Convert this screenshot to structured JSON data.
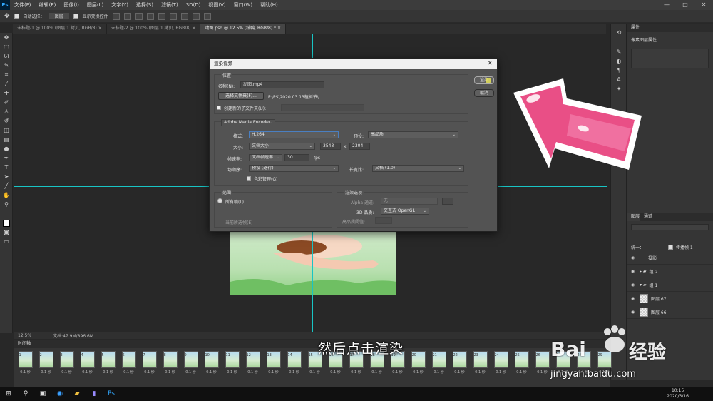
{
  "menubar": {
    "app_icon": "Ps",
    "items": [
      "文件(F)",
      "编辑(E)",
      "图像(I)",
      "图层(L)",
      "文字(Y)",
      "选择(S)",
      "滤镜(T)",
      "3D(D)",
      "视图(V)",
      "窗口(W)",
      "帮助(H)"
    ],
    "window_controls": [
      "—",
      "□",
      "✕"
    ]
  },
  "optionsbar": {
    "auto_select_label": "自动选择：",
    "auto_select_value": "图层",
    "show_transform_label": "显示变换控件"
  },
  "tabs": [
    {
      "label": "未标题-1 @ 100% (图层 1 拷贝, RGB/8)",
      "close": "×",
      "active": false
    },
    {
      "label": "未标题-2 @ 100% (图层 1 拷贝, RGB/8)",
      "close": "×",
      "active": false
    },
    {
      "label": "动图.psd @ 12.5% (绒鸭, RGB/8) *",
      "close": "×",
      "active": true
    }
  ],
  "statusbar": {
    "zoom": "12.5%",
    "doc": "文档:47.9M/896.6M"
  },
  "timeline": {
    "title": "时间轴",
    "frame_delay": "0.1 秒",
    "frame_numbers": [
      "1",
      "2",
      "3",
      "4",
      "5",
      "6",
      "7",
      "8",
      "9",
      "10",
      "11",
      "12",
      "13",
      "14",
      "15",
      "16",
      "17",
      "18",
      "19",
      "20",
      "21",
      "22",
      "23",
      "24",
      "25",
      "26",
      "27",
      "28",
      "29"
    ]
  },
  "right_panel": {
    "properties_tab": "属性",
    "properties_subtitle": "像素图层属性",
    "layers_tab": "图层",
    "channels_tab": "通道",
    "unify_label": "统一：",
    "propagate_label": "传播帧 1",
    "layers": [
      {
        "name": "投影",
        "type": "effect"
      },
      {
        "name": "组 2",
        "type": "group"
      },
      {
        "name": "组 1",
        "type": "group"
      },
      {
        "name": "图层 67",
        "type": "layer"
      },
      {
        "name": "图层 66",
        "type": "layer"
      }
    ]
  },
  "dialog": {
    "title": "渲染视频",
    "close_glyph": "✕",
    "location_group": "位置",
    "name_label": "名称(N):",
    "name_value": "动图.mp4",
    "select_folder_button": "选择文件夹(F)...",
    "folder_path": "F:\\PS\\2020.03.13植树节\\",
    "create_subfolder_label": "创建新的子文件夹(U):",
    "encoder": "Adobe Media Encoder",
    "format_label": "格式:",
    "format_value": "H.264",
    "preset_label": "预设:",
    "preset_value": "高品质",
    "size_label": "大小:",
    "size_value": "文档大小",
    "width": "3543",
    "times": "x",
    "height": "2304",
    "framerate_label": "帧速率:",
    "framerate_value": "文档帧速率",
    "fps_value": "30",
    "fps_unit": "fps",
    "field_order_label": "场顺序:",
    "field_order_value": "预设 (逐行)",
    "aspect_label": "长宽比:",
    "aspect_value": "文档 (1.0)",
    "color_mgmt_label": "色彩管理(G)",
    "range_group": "范围",
    "all_frames_label": "所有帧(L)",
    "selected_frames_label": "当前所选帧(E)",
    "render_options_group": "渲染选项",
    "alpha_label": "Alpha 通道:",
    "alpha_value": "无",
    "quality3d_label": "3D 品质:",
    "quality3d_value": "交互式 OpenGL",
    "hq_threshold_label": "高品质阈值:",
    "render_button": "渲染",
    "cancel_button": "取消"
  },
  "subtitle": "然后点击渲染",
  "watermark": {
    "brand": "Bai",
    "brand2": "经验",
    "url": "jingyan.baidu.com"
  },
  "taskbar": {
    "time": "10:15",
    "date": "2020/3/16"
  },
  "colors": {
    "accent_arrow": "#e94f86",
    "guide": "#19c4c4",
    "ps_blue": "#31a8ff"
  }
}
